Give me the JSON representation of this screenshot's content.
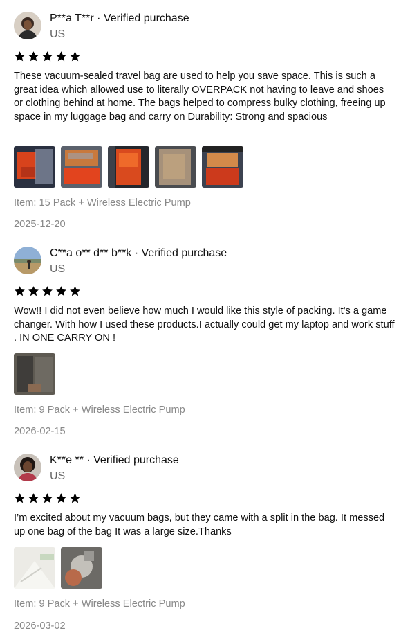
{
  "reviews": [
    {
      "name": "P**a T**r",
      "separator": " · ",
      "verified": "Verified purchase",
      "country": "US",
      "rating": 5,
      "text": "These vacuum-sealed travel bag are used to help you save space. This is such a great idea which allowed use to literally OVERPACK not having to leave and shoes or clothing behind at home. The bags helped to compress bulky clothing, freeing up space in my luggage bag and carry on Durability: Strong and spacious",
      "item": "Item: 15 Pack + Wireless Electric Pump",
      "date": "2025-12-20",
      "photo_count": 5
    },
    {
      "name": "C**a o** d** b**k",
      "separator": " · ",
      "verified": "Verified purchase",
      "country": "US",
      "rating": 5,
      "text": "Wow!! I did not even believe how much I would like this style of packing. It's a game changer. With how I used these products.I actually could get my laptop and work stuff . IN ONE CARRY ON !",
      "item": "Item: 9 Pack + Wireless Electric Pump",
      "date": "2026-02-15",
      "photo_count": 1
    },
    {
      "name": "K**e **",
      "separator": " · ",
      "verified": "Verified purchase",
      "country": "US",
      "rating": 5,
      "text": "I’m excited about my vacuum bags, but they came with a split in the bag. It messed up one bag of the bag It was a large size.Thanks",
      "item": "Item: 9 Pack + Wireless Electric Pump",
      "date": "2026-03-02",
      "photo_count": 2
    }
  ],
  "colors": {
    "text": "#111111",
    "muted": "#888888",
    "country": "#666666",
    "star": "#000000"
  },
  "icons": {
    "star": "star-icon"
  }
}
